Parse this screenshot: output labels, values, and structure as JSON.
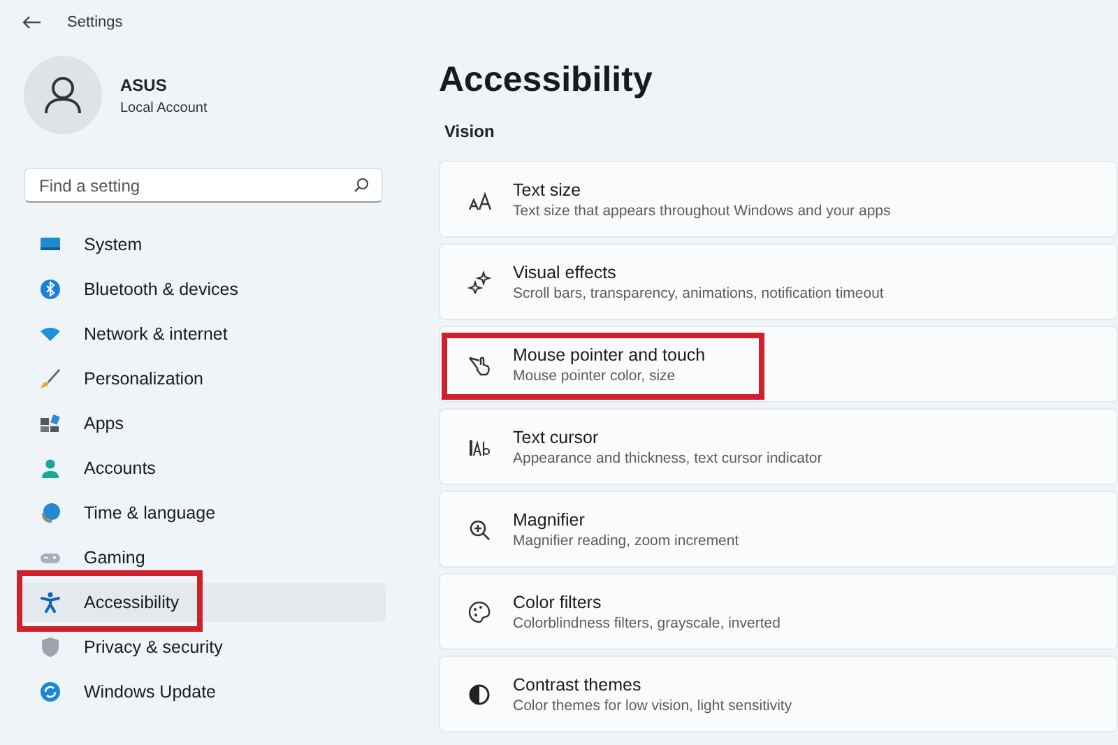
{
  "window": {
    "title": "Settings"
  },
  "account": {
    "name": "ASUS",
    "type": "Local Account"
  },
  "search": {
    "placeholder": "Find a setting"
  },
  "sidebar": {
    "items": [
      {
        "label": "System",
        "selected": false,
        "highlighted": false
      },
      {
        "label": "Bluetooth & devices",
        "selected": false,
        "highlighted": false
      },
      {
        "label": "Network & internet",
        "selected": false,
        "highlighted": false
      },
      {
        "label": "Personalization",
        "selected": false,
        "highlighted": false
      },
      {
        "label": "Apps",
        "selected": false,
        "highlighted": false
      },
      {
        "label": "Accounts",
        "selected": false,
        "highlighted": false
      },
      {
        "label": "Time & language",
        "selected": false,
        "highlighted": false
      },
      {
        "label": "Gaming",
        "selected": false,
        "highlighted": false
      },
      {
        "label": "Accessibility",
        "selected": true,
        "highlighted": true
      },
      {
        "label": "Privacy & security",
        "selected": false,
        "highlighted": false
      },
      {
        "label": "Windows Update",
        "selected": false,
        "highlighted": false
      }
    ]
  },
  "page": {
    "title": "Accessibility",
    "section": "Vision"
  },
  "cards": [
    {
      "title": "Text size",
      "subtitle": "Text size that appears throughout Windows and your apps",
      "highlighted": false
    },
    {
      "title": "Visual effects",
      "subtitle": "Scroll bars, transparency, animations, notification timeout",
      "highlighted": false
    },
    {
      "title": "Mouse pointer and touch",
      "subtitle": "Mouse pointer color, size",
      "highlighted": true
    },
    {
      "title": "Text cursor",
      "subtitle": "Appearance and thickness, text cursor indicator",
      "highlighted": false
    },
    {
      "title": "Magnifier",
      "subtitle": "Magnifier reading, zoom increment",
      "highlighted": false
    },
    {
      "title": "Color filters",
      "subtitle": "Colorblindness filters, grayscale, inverted",
      "highlighted": false
    },
    {
      "title": "Contrast themes",
      "subtitle": "Color themes for low vision, light sensitivity",
      "highlighted": false
    }
  ]
}
